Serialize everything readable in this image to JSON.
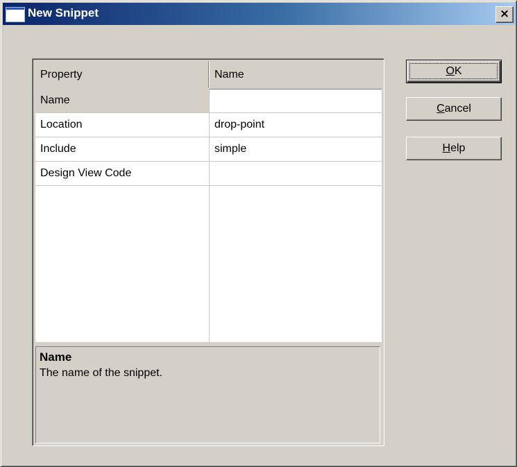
{
  "window": {
    "title": "New Snippet",
    "close_glyph": "×"
  },
  "grid": {
    "headers": [
      "Property",
      "Name"
    ],
    "rows": [
      {
        "name": "Name",
        "value": "",
        "selected": true
      },
      {
        "name": "Location",
        "value": "drop-point",
        "selected": false
      },
      {
        "name": "Include",
        "value": "simple",
        "selected": false
      },
      {
        "name": "Design View Code",
        "value": "",
        "selected": false
      }
    ]
  },
  "description": {
    "title": "Name",
    "text": "The name of the snippet."
  },
  "buttons": {
    "ok": {
      "mnemonic": "O",
      "rest": "K"
    },
    "cancel": {
      "mnemonic": "C",
      "rest": "ancel"
    },
    "help": {
      "mnemonic": "H",
      "rest": "elp"
    }
  },
  "colors": {
    "titlebar_start": "#0a246a",
    "titlebar_end": "#a6caf0",
    "face": "#d4d0c8"
  }
}
